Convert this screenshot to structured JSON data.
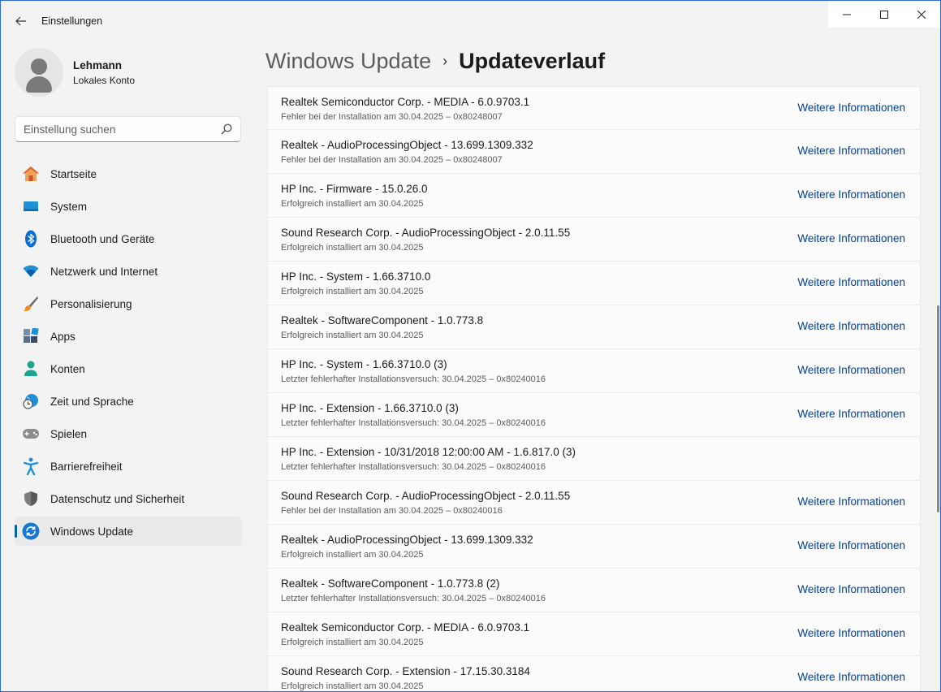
{
  "window": {
    "title": "Einstellungen"
  },
  "profile": {
    "name": "Lehmann",
    "account_type": "Lokales Konto"
  },
  "search": {
    "placeholder": "Einstellung suchen"
  },
  "sidebar": {
    "items": [
      {
        "label": "Startseite",
        "icon": "home-icon"
      },
      {
        "label": "System",
        "icon": "system-icon"
      },
      {
        "label": "Bluetooth und Geräte",
        "icon": "bluetooth-icon"
      },
      {
        "label": "Netzwerk und Internet",
        "icon": "wifi-icon"
      },
      {
        "label": "Personalisierung",
        "icon": "brush-icon"
      },
      {
        "label": "Apps",
        "icon": "apps-icon"
      },
      {
        "label": "Konten",
        "icon": "account-icon"
      },
      {
        "label": "Zeit und Sprache",
        "icon": "clock-globe-icon"
      },
      {
        "label": "Spielen",
        "icon": "gamepad-icon"
      },
      {
        "label": "Barrierefreiheit",
        "icon": "accessibility-icon"
      },
      {
        "label": "Datenschutz und Sicherheit",
        "icon": "shield-icon"
      },
      {
        "label": "Windows Update",
        "icon": "update-icon",
        "active": true
      }
    ]
  },
  "breadcrumb": {
    "parent": "Windows Update",
    "separator": "›",
    "current": "Updateverlauf"
  },
  "updates": [
    {
      "title": "Realtek Semiconductor Corp. - MEDIA - 6.0.9703.1",
      "status": "Fehler bei der Installation am 30.04.2025 – 0x80248007",
      "link": "Weitere Informationen"
    },
    {
      "title": "Realtek - AudioProcessingObject - 13.699.1309.332",
      "status": "Fehler bei der Installation am 30.04.2025 – 0x80248007",
      "link": "Weitere Informationen"
    },
    {
      "title": "HP Inc. - Firmware - 15.0.26.0",
      "status": "Erfolgreich installiert am 30.04.2025",
      "link": "Weitere Informationen"
    },
    {
      "title": "Sound Research Corp. - AudioProcessingObject - 2.0.11.55",
      "status": "Erfolgreich installiert am 30.04.2025",
      "link": "Weitere Informationen"
    },
    {
      "title": "HP Inc. - System - 1.66.3710.0",
      "status": "Erfolgreich installiert am 30.04.2025",
      "link": "Weitere Informationen"
    },
    {
      "title": "Realtek - SoftwareComponent - 1.0.773.8",
      "status": "Erfolgreich installiert am 30.04.2025",
      "link": "Weitere Informationen"
    },
    {
      "title": "HP Inc. - System - 1.66.3710.0 (3)",
      "status": "Letzter fehlerhafter Installationsversuch: 30.04.2025 – 0x80240016",
      "link": "Weitere Informationen"
    },
    {
      "title": "HP Inc. - Extension - 1.66.3710.0 (3)",
      "status": "Letzter fehlerhafter Installationsversuch: 30.04.2025 – 0x80240016",
      "link": "Weitere Informationen"
    },
    {
      "title": "HP Inc. - Extension - 10/31/2018 12:00:00 AM - 1.6.817.0 (3)",
      "status": "Letzter fehlerhafter Installationsversuch: 30.04.2025 – 0x80240016",
      "link": ""
    },
    {
      "title": "Sound Research Corp. - AudioProcessingObject - 2.0.11.55",
      "status": "Fehler bei der Installation am 30.04.2025 – 0x80240016",
      "link": "Weitere Informationen"
    },
    {
      "title": "Realtek - AudioProcessingObject - 13.699.1309.332",
      "status": "Erfolgreich installiert am 30.04.2025",
      "link": "Weitere Informationen"
    },
    {
      "title": "Realtek - SoftwareComponent - 1.0.773.8 (2)",
      "status": "Letzter fehlerhafter Installationsversuch: 30.04.2025 – 0x80240016",
      "link": "Weitere Informationen"
    },
    {
      "title": "Realtek Semiconductor Corp. - MEDIA - 6.0.9703.1",
      "status": "Erfolgreich installiert am 30.04.2025",
      "link": "Weitere Informationen"
    },
    {
      "title": "Sound Research Corp. - Extension - 17.15.30.3184",
      "status": "Erfolgreich installiert am 30.04.2025",
      "link": "Weitere Informationen"
    }
  ],
  "colors": {
    "accent": "#005fb8",
    "link": "#003e92",
    "window_border": "#2f6bd8"
  }
}
